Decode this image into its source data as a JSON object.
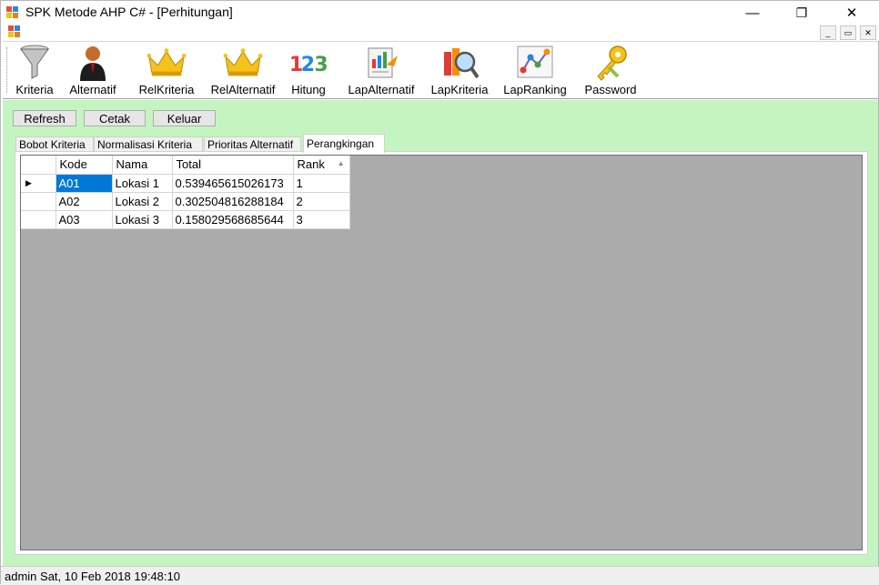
{
  "window": {
    "title": "SPK Metode AHP C# - [Perhitungan]"
  },
  "window_controls": {
    "minimize": "—",
    "restore": "❐",
    "close": "✕"
  },
  "mdi_controls": {
    "minimize": "_",
    "restore": "▭",
    "close": "✕"
  },
  "toolbar": {
    "items": [
      {
        "label": "Kriteria",
        "icon": "funnel-icon"
      },
      {
        "label": "Alternatif",
        "icon": "person-icon"
      },
      {
        "label": "RelKriteria",
        "icon": "crown-icon"
      },
      {
        "label": "RelAlternatif",
        "icon": "crown-icon"
      },
      {
        "label": "Hitung",
        "icon": "numbers-123-icon"
      },
      {
        "label": "LapAlternatif",
        "icon": "report-chart-icon"
      },
      {
        "label": "LapKriteria",
        "icon": "magnifier-report-icon"
      },
      {
        "label": "LapRanking",
        "icon": "network-chart-icon"
      },
      {
        "label": "Password",
        "icon": "keys-icon"
      }
    ]
  },
  "actions": {
    "refresh": "Refresh",
    "cetak": "Cetak",
    "keluar": "Keluar"
  },
  "tabs": [
    {
      "label": "Bobot Kriteria",
      "active": false
    },
    {
      "label": "Normalisasi Kriteria",
      "active": false
    },
    {
      "label": "Prioritas Alternatif",
      "active": false
    },
    {
      "label": "Perangkingan",
      "active": true
    }
  ],
  "grid": {
    "columns": [
      "Kode",
      "Nama",
      "Total",
      "Rank"
    ],
    "sort_indicator": "▲",
    "current_row_marker": "▶",
    "rows": [
      [
        "A01",
        "Lokasi 1",
        "0.539465615026173",
        "1"
      ],
      [
        "A02",
        "Lokasi 2",
        "0.302504816288184",
        "2"
      ],
      [
        "A03",
        "Lokasi 3",
        "0.158029568685644",
        "3"
      ]
    ]
  },
  "status": {
    "text": "admin Sat, 10 Feb 2018 19:48:10"
  },
  "colors": {
    "content_bg": "#c4f5c0",
    "grid_bg": "#ababab",
    "selection": "#0078d7"
  }
}
